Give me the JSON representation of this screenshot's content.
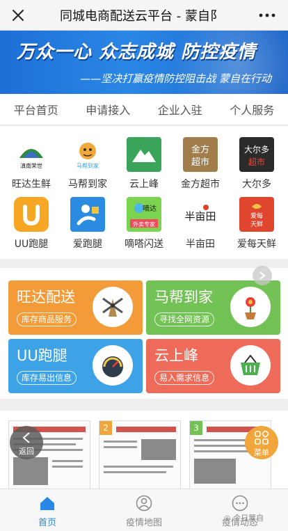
{
  "topbar": {
    "title": "同城电商配送云平台 - 蒙自阝"
  },
  "banner": {
    "headline": "万众一心 众志成城 防控疫情",
    "subline": "——坚决打赢疫情防控阻击战 蒙自在行动"
  },
  "tabs": [
    "平台首页",
    "申请接入",
    "企业入驻",
    "个人服务"
  ],
  "apps": [
    {
      "label": "旺达生鲜",
      "logo_text": "滇南荣世"
    },
    {
      "label": "马帮到家",
      "logo_text": "马帮到家"
    },
    {
      "label": "云上峰",
      "logo_text": ""
    },
    {
      "label": "金方超市",
      "logo_text": "金方超市"
    },
    {
      "label": "大尔多",
      "logo_text": "大尔多超市"
    },
    {
      "label": "UU跑腿",
      "logo_text": "U"
    },
    {
      "label": "爱跑腿",
      "logo_text": ""
    },
    {
      "label": "嘀嗒闪送",
      "logo_text": "嘀达 外卖专家"
    },
    {
      "label": "半亩田",
      "logo_text": "半亩田"
    },
    {
      "label": "爱每天鲜",
      "logo_text": "爱每天鲜"
    }
  ],
  "cards": [
    {
      "title": "旺达配送",
      "subtitle": "库存商品服务",
      "color": "#f29b38",
      "icon": "windmill-icon"
    },
    {
      "title": "马帮到家",
      "subtitle": "寻找全网资源",
      "color": "#72c255",
      "icon": "flower-pot-icon"
    },
    {
      "title": "UU跑腿",
      "subtitle": "库存易出信息",
      "color": "#3ea2e6",
      "icon": "gauge-icon"
    },
    {
      "title": "云上峰",
      "subtitle": "易入需求信息",
      "color": "#ee6b5a",
      "icon": "basket-icon"
    }
  ],
  "papers": [
    {
      "num": ""
    },
    {
      "num": "2"
    },
    {
      "num": "3"
    }
  ],
  "floating": {
    "back_label": "返回",
    "menu_label": "菜单"
  },
  "bottom_tabs": [
    {
      "label": "首页",
      "active": true,
      "icon": "home-icon"
    },
    {
      "label": "疫情地图",
      "active": false,
      "icon": "person-icon"
    },
    {
      "label": "疫情动态",
      "active": false,
      "icon": "chat-icon"
    }
  ],
  "watermark": "今日蒙自",
  "colors": {
    "accent": "#2b87e6",
    "active_tab": "#2b87e6"
  }
}
